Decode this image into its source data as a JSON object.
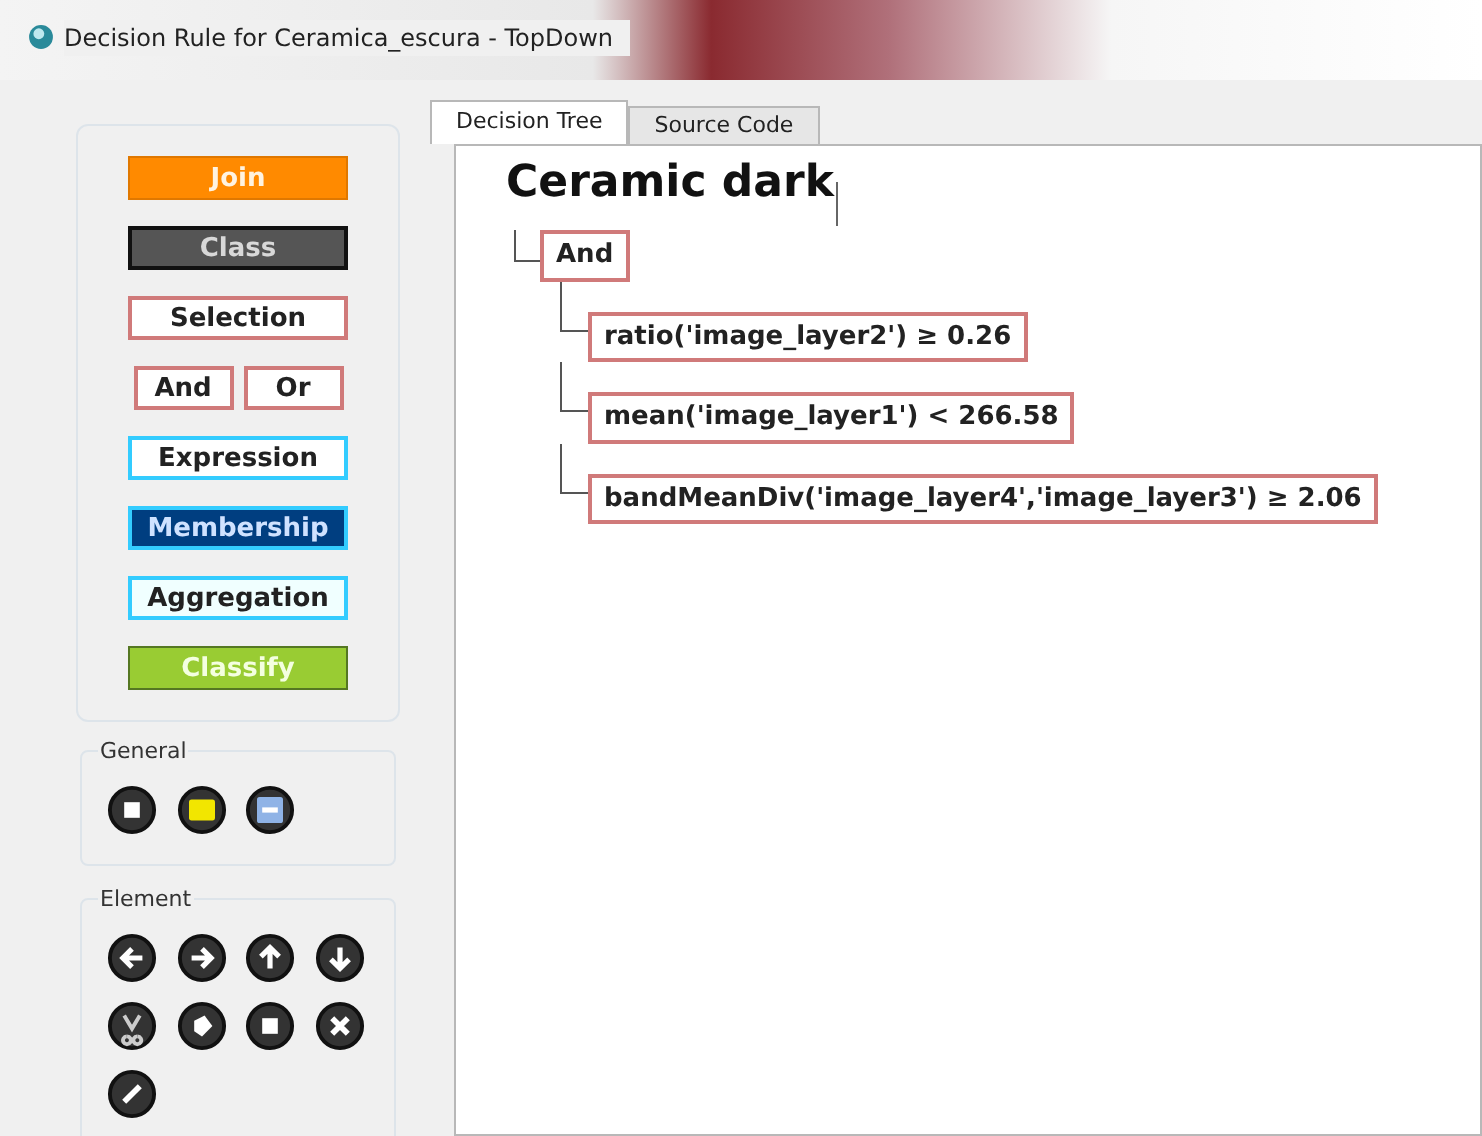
{
  "window": {
    "title": "Decision Rule for Ceramica_escura - TopDown"
  },
  "palette": [
    [
      {
        "label": "Join",
        "kind": "join"
      }
    ],
    [
      {
        "label": "Class",
        "kind": "class"
      }
    ],
    [
      {
        "label": "Selection",
        "kind": "selection"
      }
    ],
    [
      {
        "label": "And",
        "kind": "selection"
      },
      {
        "label": "Or",
        "kind": "selection"
      }
    ],
    [
      {
        "label": "Expression",
        "kind": "expression"
      }
    ],
    [
      {
        "label": "Membership",
        "kind": "membership"
      }
    ],
    [
      {
        "label": "Aggregation",
        "kind": "aggregation"
      }
    ],
    [
      {
        "label": "Classify",
        "kind": "classify"
      }
    ]
  ],
  "general": {
    "title": "General",
    "tools": [
      {
        "kind": "square"
      },
      {
        "kind": "folder"
      },
      {
        "kind": "disk"
      }
    ]
  },
  "element": {
    "title": "Element",
    "tools": [
      {
        "kind": "left"
      },
      {
        "kind": "right"
      },
      {
        "kind": "up"
      },
      {
        "kind": "down"
      },
      {
        "kind": "scissors"
      },
      {
        "kind": "shape"
      },
      {
        "kind": "square"
      },
      {
        "kind": "close"
      },
      {
        "kind": "pencil"
      }
    ]
  },
  "tabs": [
    {
      "label": "Decision Tree",
      "selected": true
    },
    {
      "label": "Source Code",
      "selected": false
    }
  ],
  "tree": {
    "title": "Ceramic dark",
    "root": {
      "label": "And",
      "children": [
        {
          "label": "ratio('image_layer2') ≥ 0.26"
        },
        {
          "label": "mean('image_layer1') < 266.58"
        },
        {
          "label": "bandMeanDiv('image_layer4','image_layer3') ≥ 2.06"
        }
      ]
    }
  }
}
